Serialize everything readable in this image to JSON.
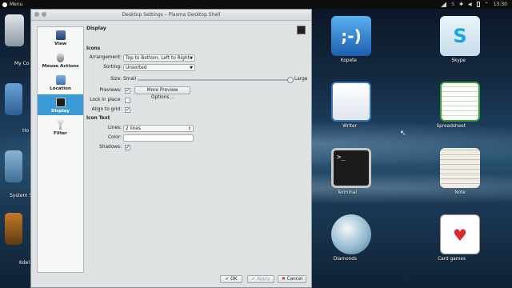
{
  "panel": {
    "menu_label": "Menu",
    "clock": "13:30"
  },
  "desktop_icons": [
    {
      "label": "Kopete",
      "icon": "kopete-icon",
      "color": "#2f84d6"
    },
    {
      "label": "Skype",
      "icon": "skype-icon",
      "color": "#1aa3e8"
    },
    {
      "label": "Writer",
      "icon": "writer-icon",
      "color": "#3a77b5"
    },
    {
      "label": "Spreadsheet",
      "icon": "spreadsheet-icon",
      "color": "#3f9b3a"
    },
    {
      "label": "Terminal",
      "icon": "terminal-icon",
      "color": "#1b1b1b"
    },
    {
      "label": "Note",
      "icon": "note-icon",
      "color": "#e9e6df"
    },
    {
      "label": "Diamonds",
      "icon": "diamonds-icon",
      "color": "#6e9bb5"
    },
    {
      "label": "Card games",
      "icon": "card-games-icon",
      "color": "#d92b2b"
    }
  ],
  "left_icons": [
    {
      "label": "My Co",
      "icon": "computer-icon"
    },
    {
      "label": "Ho",
      "icon": "home-folder-icon"
    },
    {
      "label": "System S",
      "icon": "system-settings-icon"
    },
    {
      "label": "Kdel",
      "icon": "media-icon"
    }
  ],
  "dialog": {
    "title": "Desktop Settings – Plasma Desktop Shell",
    "sidebar": [
      {
        "label": "View",
        "icon": "view-icon"
      },
      {
        "label": "Mouse Actions",
        "icon": "mouse-icon"
      },
      {
        "label": "Location",
        "icon": "folder-icon"
      },
      {
        "label": "Display",
        "icon": "display-icon",
        "selected": true
      },
      {
        "label": "Filter",
        "icon": "filter-icon"
      }
    ],
    "content_title": "Display",
    "icons_section": "Icons",
    "arrangement_label": "Arrangement:",
    "arrangement_value": "Top to Bottom, Left to Right",
    "sorting_label": "Sorting:",
    "sorting_value": "Unsorted",
    "size_label": "Size:",
    "size_small": "Small",
    "size_large": "Large",
    "size_level": 1.0,
    "previews_label": "Previews:",
    "previews_checked": true,
    "more_previews_button": "More Preview Options...",
    "lock_label": "Lock in place:",
    "lock_checked": false,
    "align_label": "Align to grid:",
    "align_checked": true,
    "icon_text_section": "Icon Text",
    "lines_label": "Lines:",
    "lines_value": "2 lines",
    "color_label": "Color:",
    "color_value": "#ffffff",
    "shadows_label": "Shadows:",
    "shadows_checked": true,
    "ok_button": "OK",
    "apply_button": "Apply",
    "cancel_button": "Cancel"
  }
}
